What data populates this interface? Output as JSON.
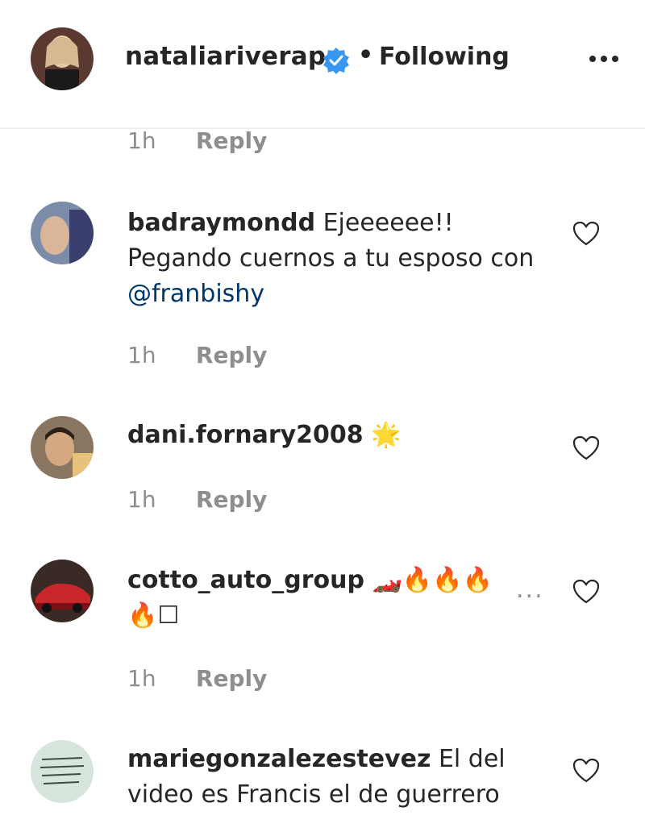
{
  "post": {
    "username": "nataliariverapr",
    "separator": "•",
    "follow_status": "Following"
  },
  "icons": {
    "more": "more-horizontal-icon",
    "verified": "verified-badge-icon",
    "like": "heart-outline-icon"
  },
  "colors": {
    "verified": "#3897f0",
    "mention": "#00376b",
    "muted": "#8e8e8e"
  },
  "previous_meta": {
    "time": "1h",
    "reply": "Reply"
  },
  "comments": [
    {
      "username": "badraymondd",
      "text_first": "Ejeeeeee!!",
      "text_rest": "Pegando cuernos a tu esposo con",
      "mention": "@franbishy",
      "time": "1h",
      "reply": "Reply"
    },
    {
      "username": "dani.fornary2008",
      "text": "🌟",
      "time": "1h",
      "reply": "Reply"
    },
    {
      "username": "cotto_auto_group",
      "text": "🏎️🔥🔥🔥",
      "text_line2": "🔥☐",
      "more": "...",
      "time": "1h",
      "reply": "Reply"
    },
    {
      "username": "mariegonzalezestevez",
      "text": "El del video es Francis el de guerrero"
    }
  ]
}
